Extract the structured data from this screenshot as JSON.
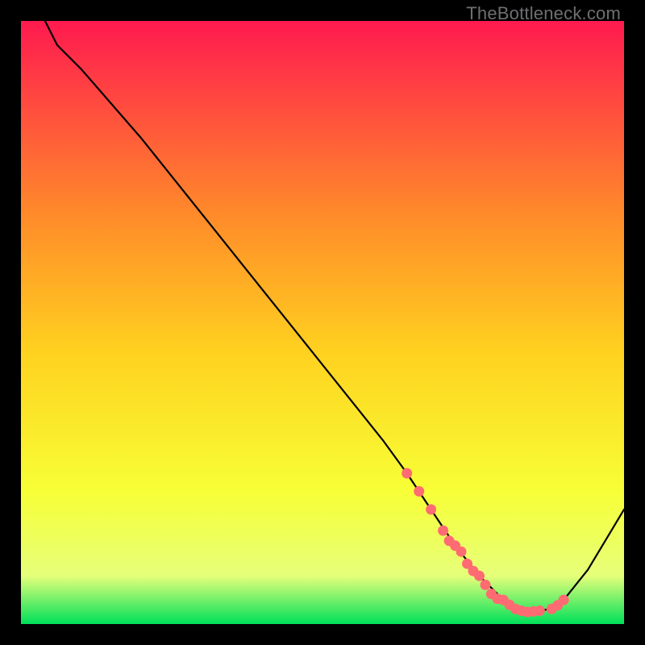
{
  "watermark": "TheBottleneck.com",
  "chart_data": {
    "type": "line",
    "title": "",
    "xlabel": "",
    "ylabel": "",
    "xlim": [
      0,
      100
    ],
    "ylim": [
      0,
      100
    ],
    "grid": false,
    "background_gradient": {
      "top": "#ff1a4f",
      "mid_upper": "#ff8a2a",
      "mid": "#ffd21f",
      "mid_lower": "#f7ff36",
      "lower": "#e6ff7a",
      "bottom": "#00e05a"
    },
    "series": [
      {
        "name": "curve",
        "x": [
          4,
          6,
          10,
          20,
          30,
          40,
          50,
          60,
          64,
          68,
          72,
          76,
          80,
          84,
          88,
          90,
          94,
          100
        ],
        "y": [
          100,
          96,
          92,
          80.5,
          68,
          55.5,
          43,
          30.5,
          25,
          19,
          13,
          8,
          4,
          2,
          2.5,
          4,
          9,
          19
        ]
      }
    ],
    "markers": {
      "name": "highlighted-points",
      "color": "#ff6b72",
      "x": [
        64,
        66,
        68,
        70,
        71,
        72,
        73,
        74,
        75,
        76,
        77,
        78,
        79,
        80,
        81,
        82,
        83,
        84,
        85,
        86,
        88,
        89,
        90
      ],
      "y": [
        25,
        22,
        19,
        15.5,
        13.8,
        13,
        12,
        10,
        8.8,
        8,
        6.5,
        5,
        4.2,
        4,
        3.2,
        2.5,
        2.2,
        2,
        2.1,
        2.2,
        2.5,
        3.1,
        4
      ]
    }
  }
}
